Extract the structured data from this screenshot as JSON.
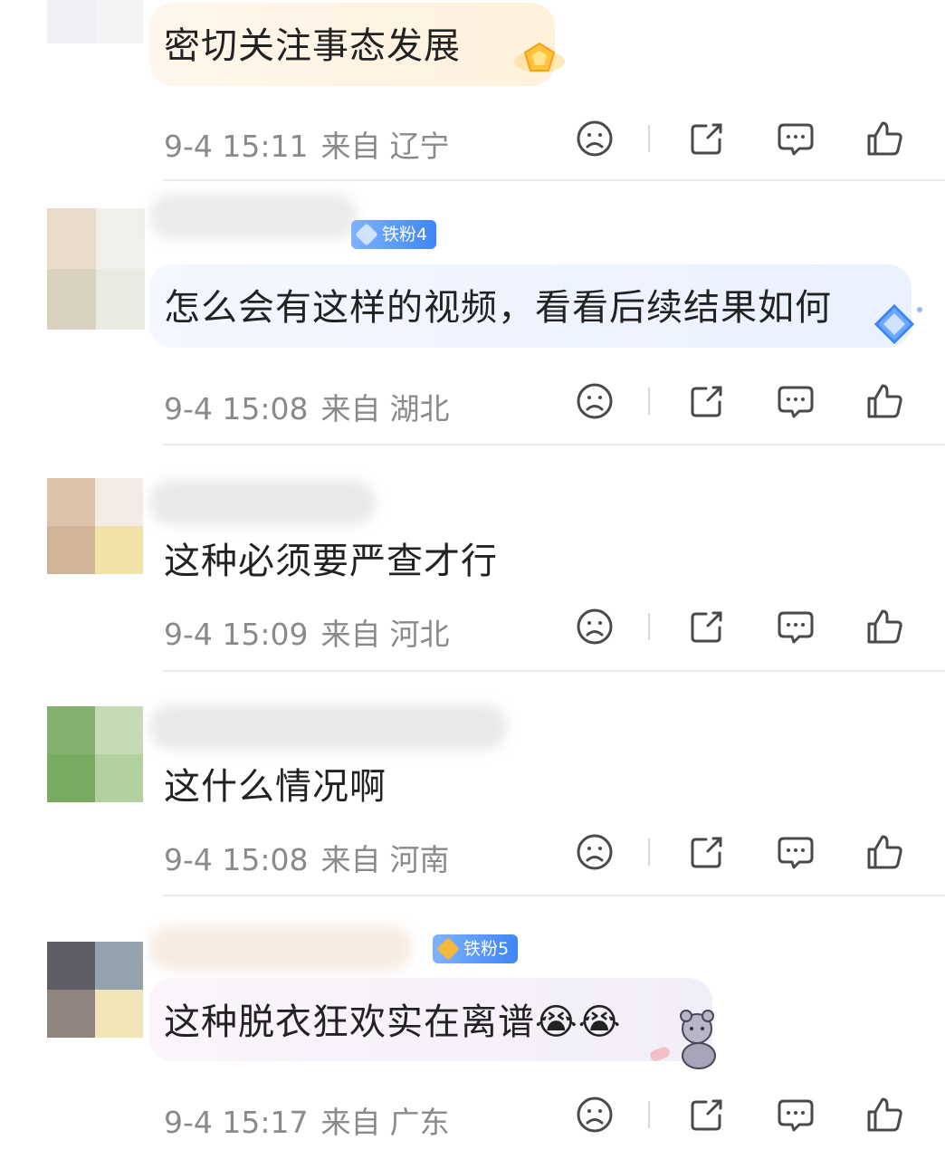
{
  "comments": [
    {
      "text": "密切关注事态发展",
      "date": "9-4 15:11",
      "from_label": "来自",
      "region": "辽宁",
      "badge": ""
    },
    {
      "text": "怎么会有这样的视频，看看后续结果如何",
      "date": "9-4 15:08",
      "from_label": "来自",
      "region": "湖北",
      "badge": "铁粉4"
    },
    {
      "text": "这种必须要严查才行",
      "date": "9-4 15:09",
      "from_label": "来自",
      "region": "河北",
      "badge": ""
    },
    {
      "text": "这什么情况啊",
      "date": "9-4 15:08",
      "from_label": "来自",
      "region": "河南",
      "badge": ""
    },
    {
      "text": "这种脱衣狂欢实在离谱😭😭",
      "date": "9-4 15:17",
      "from_label": "来自",
      "region": "广东",
      "badge": "铁粉5"
    }
  ],
  "icons": {
    "dislike": "sad-face-icon",
    "share": "share-icon",
    "reply": "comment-bubble-icon",
    "like": "thumbs-up-icon"
  },
  "colors": {
    "text": "#222222",
    "meta": "#8a8a8a",
    "icon": "#4a4a4a",
    "badge_blue": "#3d86f5"
  }
}
